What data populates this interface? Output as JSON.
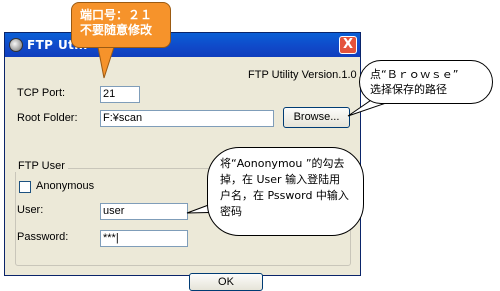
{
  "window": {
    "title": "FTP Utili",
    "close_glyph": "X"
  },
  "header": {
    "version": "FTP Utility Version.1.0"
  },
  "form": {
    "tcp_port_label": "TCP Port:",
    "tcp_port_value": "21",
    "root_folder_label": "Root Folder:",
    "root_folder_value": "F:¥scan",
    "browse_label": "Browse..."
  },
  "ftp_user": {
    "group_title": "FTP User",
    "anonymous_label": "Anonymous",
    "anonymous_checked": false,
    "user_label": "User:",
    "user_value": "user",
    "password_label": "Password:",
    "password_value": "***|"
  },
  "footer": {
    "ok_label": "OK"
  },
  "callouts": {
    "port_note": "端口号：２１\n不要随意修改",
    "browse_note": "点“Ｂｒｏｗｓｅ”\n选择保存的路径",
    "user_note": "将“Aononymou ”的勾去掉，在 User 输入登陆用户名，在 Pssword 中输入密码"
  },
  "colors": {
    "titlebar": "#1048c8",
    "window_bg": "#ece9d8",
    "port_callout_bg": "#f6932b",
    "close_button": "#e4533c"
  },
  "icons": [
    "app-icon",
    "close-icon"
  ]
}
